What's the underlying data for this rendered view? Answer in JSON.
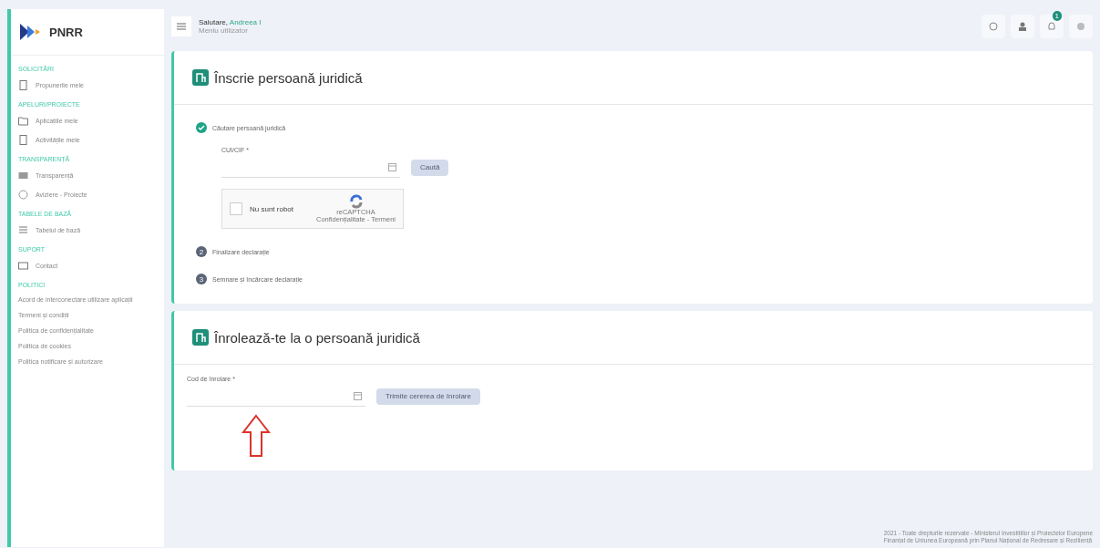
{
  "logo": {
    "text": "PNRR"
  },
  "sidebar": {
    "sections": [
      {
        "heading": "SOLICITĂRI",
        "items": [
          {
            "label": "Propunerile mele"
          }
        ]
      },
      {
        "heading": "APELURI/PROIECTE",
        "items": [
          {
            "label": "Aplicațiile mele"
          },
          {
            "label": "Activitățile mele"
          }
        ]
      },
      {
        "heading": "TRANSPARENȚĂ",
        "items": [
          {
            "label": "Transparență"
          },
          {
            "label": "Aviziere - Proiecte"
          }
        ]
      },
      {
        "heading": "TABELE DE BAZĂ",
        "items": [
          {
            "label": "Tabelul de bază"
          }
        ]
      },
      {
        "heading": "SUPORT",
        "items": [
          {
            "label": "Contact"
          }
        ]
      },
      {
        "heading": "POLITICI",
        "items": [
          {
            "label": "Acord de interconectare utilizare aplicații"
          },
          {
            "label": "Termeni și condiții"
          },
          {
            "label": "Politica de confidențialitate"
          },
          {
            "label": "Politica de cookies"
          },
          {
            "label": "Politica notificare și autorizare"
          }
        ]
      }
    ]
  },
  "header": {
    "greeting": "Salutare,",
    "name": "Andreea I",
    "subtitle": "Meniu utilizator",
    "notification_badge": "1"
  },
  "register_card": {
    "title": "Înscrie persoană juridică",
    "steps": [
      {
        "label": "Căutare persoană juridică",
        "done": true
      },
      {
        "number": "2",
        "label": "Finalizare declarație",
        "done": false
      },
      {
        "number": "3",
        "label": "Semnare și încărcare declarație",
        "done": false
      }
    ],
    "field_label": "CUI/CIF *",
    "search_button": "Caută",
    "captcha_checked": false,
    "captcha_label": "Nu sunt robot",
    "captcha_footer": "reCAPTCHA\nConfidențialitate - Termeni"
  },
  "enroll_card": {
    "title": "Înrolează-te la o persoană juridică",
    "field_label": "Cod de înrolare *",
    "submit_button": "Trimite cererea de înrolare"
  },
  "footer": [
    "2021 - Toate drepturile rezervate - Ministerul Investițiilor și Proiectelor Europene",
    "Finanțat de Uniunea Europeană prin Planul Național de Redresare și Reziliență"
  ]
}
